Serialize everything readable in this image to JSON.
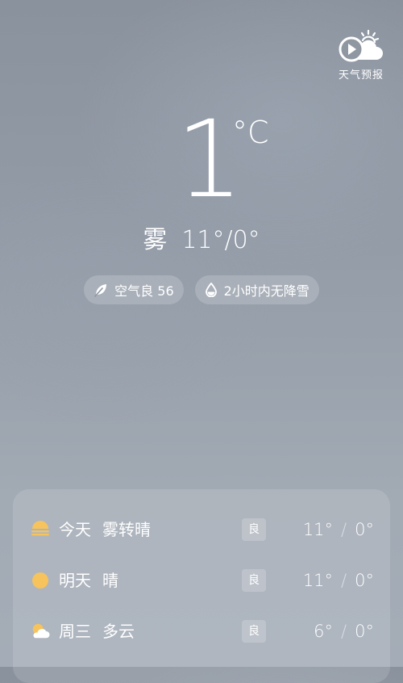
{
  "header": {
    "forecast_label": "天气预报"
  },
  "current": {
    "temperature": "1",
    "unit": "°C",
    "condition": "雾",
    "high_low": "11°/0°"
  },
  "chips": {
    "air_quality": "空气良 56",
    "precipitation": "2小时内无降雪"
  },
  "forecast": [
    {
      "day": "今天",
      "condition": "雾转晴",
      "air": "良",
      "high": "11°",
      "sep": "/",
      "low": "0°",
      "icon": "fog-icon"
    },
    {
      "day": "明天",
      "condition": "晴",
      "air": "良",
      "high": "11°",
      "sep": "/",
      "low": "0°",
      "icon": "sun-icon"
    },
    {
      "day": "周三",
      "condition": "多云",
      "air": "良",
      "high": "6°",
      "sep": "/",
      "low": "0°",
      "icon": "partly-cloudy-icon"
    }
  ],
  "colors": {
    "sun": "#f6c35c",
    "text": "#ffffff"
  }
}
